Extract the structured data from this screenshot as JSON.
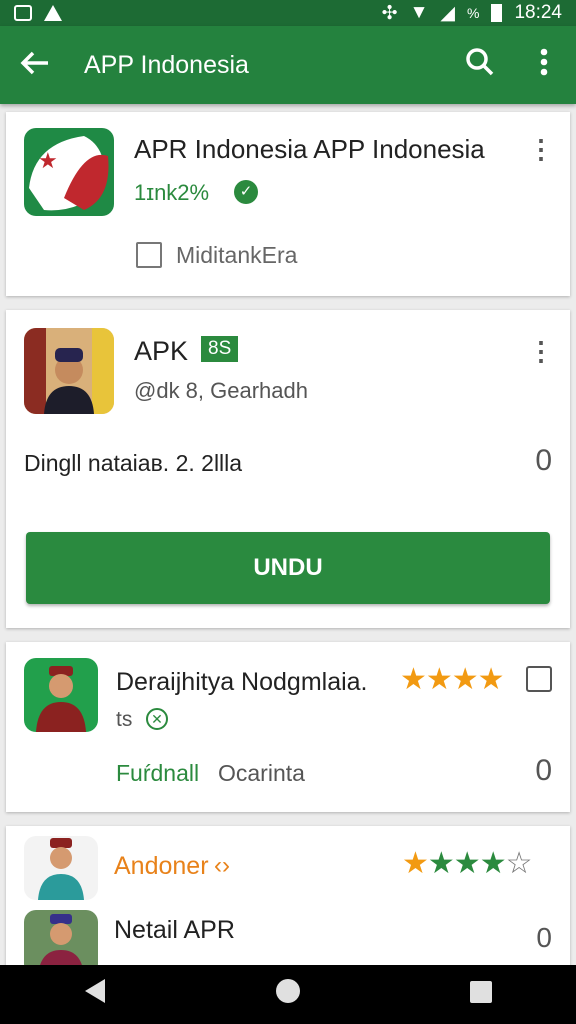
{
  "status_bar": {
    "time": "18:24",
    "battery_text": "%"
  },
  "app_bar": {
    "back_icon": "arrow-left-icon",
    "title": "APP Indonesia",
    "search_icon": "search-icon",
    "more_icon": "more-vert-icon"
  },
  "card1": {
    "title": "APR Indonesia APP Indonesia",
    "meta": "1ɪnk2%",
    "checkbox_label": "MiditankEra",
    "checked": false
  },
  "card2": {
    "title": "APK",
    "badge": "8S",
    "subtitle": "@dk 8, Gearhadh",
    "info": "Dingll nataiaв. 2. 2llla",
    "side_value": "0",
    "button_label": "UNDU"
  },
  "card3": {
    "title": "Deraijhitya Nodgmlaia.",
    "meta": "ts",
    "link_text": "Fuŕdnall",
    "link_text2": "Ocarinta",
    "side_value": "0",
    "rating": 4
  },
  "card4": {
    "title": "Andoner",
    "sub_title": "Netail APR",
    "side_value": "0",
    "rating": 4
  },
  "colors": {
    "status_bar": "#1d6b34",
    "app_bar": "#24823e",
    "button": "#2a8a3f",
    "star_orange": "#f29a12",
    "star_green": "#2b8a3e"
  },
  "nav_bar": {
    "back_icon": "triangle-back-icon",
    "home_icon": "circle-home-icon",
    "recents_icon": "square-recents-icon"
  }
}
